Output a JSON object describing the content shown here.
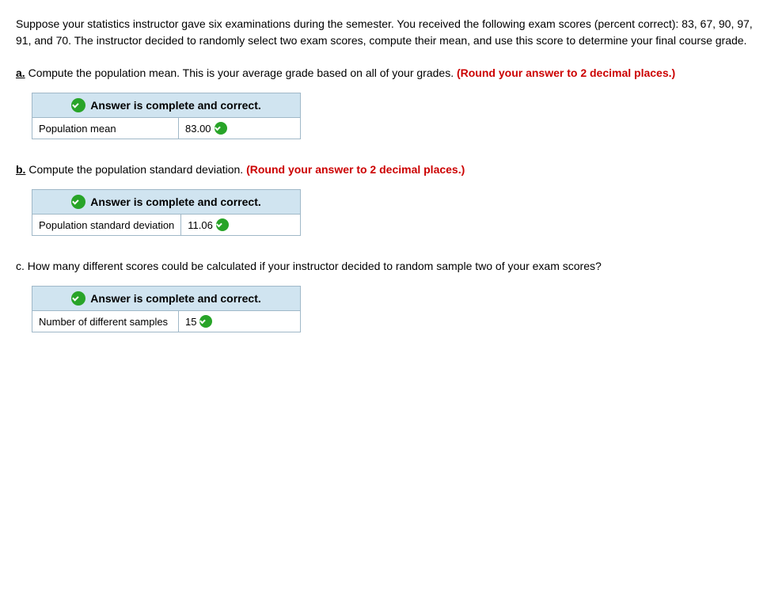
{
  "intro": {
    "text": "Suppose your statistics instructor gave six examinations during the semester. You received the following exam scores (percent correct): 83, 67, 90, 97, 91, and 70. The instructor decided to randomly select two exam scores, compute their mean, and use this score to determine your final course grade."
  },
  "questions": {
    "a": {
      "letter": "a.",
      "text": " Compute the population mean. This is your average grade based on all of your grades. ",
      "round_note": "(Round your answer to 2 decimal places.)",
      "answer_header": "Answer is complete and correct.",
      "row_label": "Population mean",
      "row_value": "83.00"
    },
    "b": {
      "letter": "b.",
      "text": " Compute the population standard deviation. ",
      "round_note": "(Round your answer to 2 decimal places.)",
      "answer_header": "Answer is complete and correct.",
      "row_label": "Population standard deviation",
      "row_value": "11.06"
    },
    "c": {
      "letter": "c.",
      "text": " How many different scores could be calculated if your instructor decided to random sample two of your exam scores?",
      "answer_header": "Answer is complete and correct.",
      "row_label": "Number of different samples",
      "row_value": "15"
    }
  }
}
